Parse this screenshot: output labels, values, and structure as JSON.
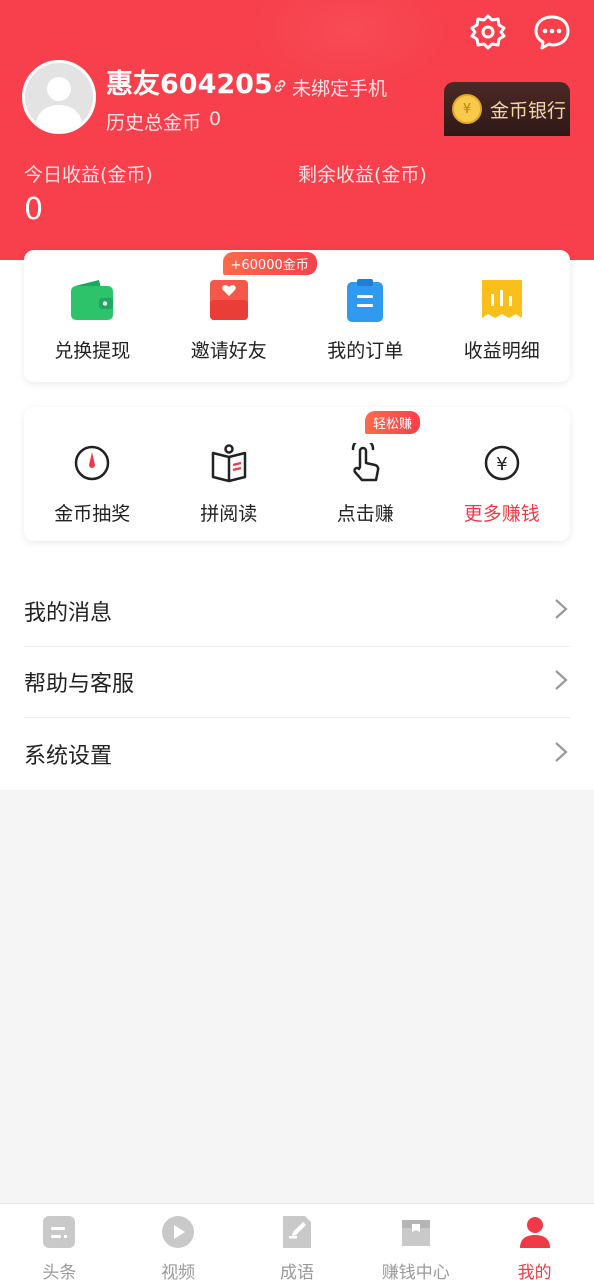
{
  "header": {
    "username": "惠友604205",
    "bind_phone": "未绑定手机",
    "history_label": "历史总金币",
    "history_value": "0",
    "bank_label": "金币银行",
    "bank_coin_symbol": "¥",
    "today_label": "今日收益(金币)",
    "today_value": "0",
    "remaining_label": "剩余收益(金币)",
    "accent_color": "#f7404b"
  },
  "quick_actions": [
    {
      "label": "兑换提现",
      "icon": "wallet-icon"
    },
    {
      "label": "邀请好友",
      "icon": "invite-envelope-icon",
      "badge": "+60000金币"
    },
    {
      "label": "我的订单",
      "icon": "clipboard-icon"
    },
    {
      "label": "收益明细",
      "icon": "receipt-icon"
    }
  ],
  "earn_actions": [
    {
      "label": "金币抽奖",
      "icon": "lottery-dial-icon"
    },
    {
      "label": "拼阅读",
      "icon": "book-icon"
    },
    {
      "label": "点击赚",
      "icon": "tap-hand-icon",
      "badge": "轻松赚"
    },
    {
      "label": "更多赚钱",
      "icon": "yen-circle-icon",
      "highlight": true
    }
  ],
  "menu": [
    {
      "label": "我的消息"
    },
    {
      "label": "帮助与客服"
    },
    {
      "label": "系统设置"
    }
  ],
  "tabs": [
    {
      "label": "头条",
      "icon": "news-icon",
      "active": false
    },
    {
      "label": "视频",
      "icon": "play-icon",
      "active": false
    },
    {
      "label": "成语",
      "icon": "edit-doc-icon",
      "active": false
    },
    {
      "label": "赚钱中心",
      "icon": "treasure-box-icon",
      "active": false
    },
    {
      "label": "我的",
      "icon": "user-icon",
      "active": true
    }
  ]
}
